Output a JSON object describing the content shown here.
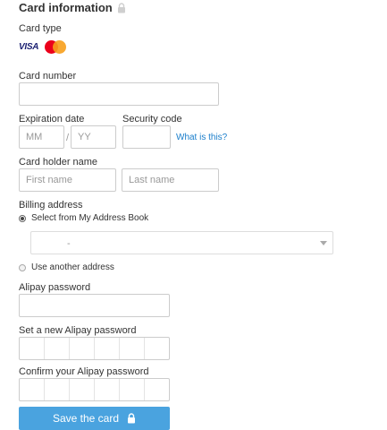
{
  "title": "Card information",
  "card_type": {
    "label": "Card type",
    "brands": [
      "VISA",
      "MasterCard"
    ]
  },
  "card_number": {
    "label": "Card number",
    "value": ""
  },
  "expiration": {
    "label": "Expiration date",
    "month_placeholder": "MM",
    "year_placeholder": "YY",
    "separator": "/"
  },
  "security": {
    "label": "Security code",
    "help_link": "What is this?"
  },
  "holder": {
    "label": "Card holder name",
    "first_placeholder": "First name",
    "last_placeholder": "Last name"
  },
  "billing": {
    "label": "Billing address",
    "option_book": "Select from My Address Book",
    "selected_address": "-",
    "option_other": "Use another address",
    "selected_option": "book"
  },
  "alipay_password": {
    "label": "Alipay password"
  },
  "new_alipay_password": {
    "label": "Set a new Alipay password",
    "digits": 6
  },
  "confirm_alipay_password": {
    "label": "Confirm your Alipay password",
    "digits": 6
  },
  "submit_label": "Save the card",
  "colors": {
    "accent": "#4aa3df",
    "link": "#1a7ecb",
    "border": "#cccccc"
  }
}
